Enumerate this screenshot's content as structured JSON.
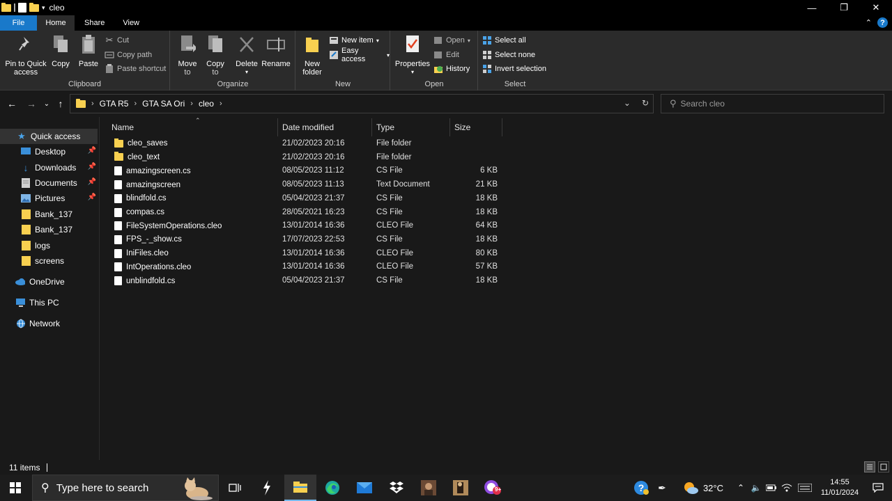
{
  "window": {
    "title": "cleo"
  },
  "tabs": [
    {
      "label": "File"
    },
    {
      "label": "Home"
    },
    {
      "label": "Share"
    },
    {
      "label": "View"
    }
  ],
  "ribbon": {
    "clipboard": {
      "label": "Clipboard",
      "pin_line1": "Pin to Quick",
      "pin_line2": "access",
      "copy": "Copy",
      "paste": "Paste",
      "cut": "Cut",
      "copy_path": "Copy path",
      "paste_shortcut": "Paste shortcut"
    },
    "organize": {
      "label": "Organize",
      "move_line1": "Move",
      "move_line2": "to",
      "copy_line1": "Copy",
      "copy_line2": "to",
      "delete": "Delete",
      "rename": "Rename"
    },
    "new": {
      "label": "New",
      "folder_line1": "New",
      "folder_line2": "folder",
      "new_item": "New item",
      "easy_access": "Easy access"
    },
    "open": {
      "label": "Open",
      "properties": "Properties",
      "open": "Open",
      "edit": "Edit",
      "history": "History"
    },
    "select": {
      "label": "Select",
      "select_all": "Select all",
      "select_none": "Select none",
      "invert": "Invert selection"
    }
  },
  "address": {
    "crumbs": [
      "GTA R5",
      "GTA SA Ori",
      "cleo"
    ],
    "search_placeholder": "Search cleo"
  },
  "navpane": {
    "quick_access": "Quick access",
    "items": [
      {
        "label": "Desktop",
        "pinned": true
      },
      {
        "label": "Downloads",
        "pinned": true
      },
      {
        "label": "Documents",
        "pinned": true
      },
      {
        "label": "Pictures",
        "pinned": true
      },
      {
        "label": "Bank_137",
        "pinned": false
      },
      {
        "label": "Bank_137",
        "pinned": false
      },
      {
        "label": "logs",
        "pinned": false
      },
      {
        "label": "screens",
        "pinned": false
      }
    ],
    "onedrive": "OneDrive",
    "thispc": "This PC",
    "network": "Network"
  },
  "columns": {
    "name": "Name",
    "date": "Date modified",
    "type": "Type",
    "size": "Size"
  },
  "files": [
    {
      "name": "cleo_saves",
      "date": "21/02/2023 20:16",
      "type": "File folder",
      "size": "",
      "kind": "folder"
    },
    {
      "name": "cleo_text",
      "date": "21/02/2023 20:16",
      "type": "File folder",
      "size": "",
      "kind": "folder"
    },
    {
      "name": "amazingscreen.cs",
      "date": "08/05/2023 11:12",
      "type": "CS File",
      "size": "6 KB",
      "kind": "file"
    },
    {
      "name": "amazingscreen",
      "date": "08/05/2023 11:13",
      "type": "Text Document",
      "size": "21 KB",
      "kind": "text"
    },
    {
      "name": "blindfold.cs",
      "date": "05/04/2023 21:37",
      "type": "CS File",
      "size": "18 KB",
      "kind": "file"
    },
    {
      "name": "compas.cs",
      "date": "28/05/2021 16:23",
      "type": "CS File",
      "size": "18 KB",
      "kind": "file"
    },
    {
      "name": "FileSystemOperations.cleo",
      "date": "13/01/2014 16:36",
      "type": "CLEO File",
      "size": "64 KB",
      "kind": "file"
    },
    {
      "name": "FPS_-_show.cs",
      "date": "17/07/2023 22:53",
      "type": "CS File",
      "size": "18 KB",
      "kind": "file"
    },
    {
      "name": "IniFiles.cleo",
      "date": "13/01/2014 16:36",
      "type": "CLEO File",
      "size": "80 KB",
      "kind": "file"
    },
    {
      "name": "IntOperations.cleo",
      "date": "13/01/2014 16:36",
      "type": "CLEO File",
      "size": "57 KB",
      "kind": "file"
    },
    {
      "name": "unblindfold.cs",
      "date": "05/04/2023 21:37",
      "type": "CS File",
      "size": "18 KB",
      "kind": "file"
    }
  ],
  "status": {
    "count": "11 items"
  },
  "taskbar": {
    "search_placeholder": "Type here to search",
    "weather": "32°C",
    "time": "14:55",
    "date": "11/01/2024",
    "mail_badge": "9+"
  },
  "colors": {
    "accent": "#1979ca",
    "folder": "#f8d050",
    "background": "#191919",
    "ribbon": "#2b2b2b"
  }
}
